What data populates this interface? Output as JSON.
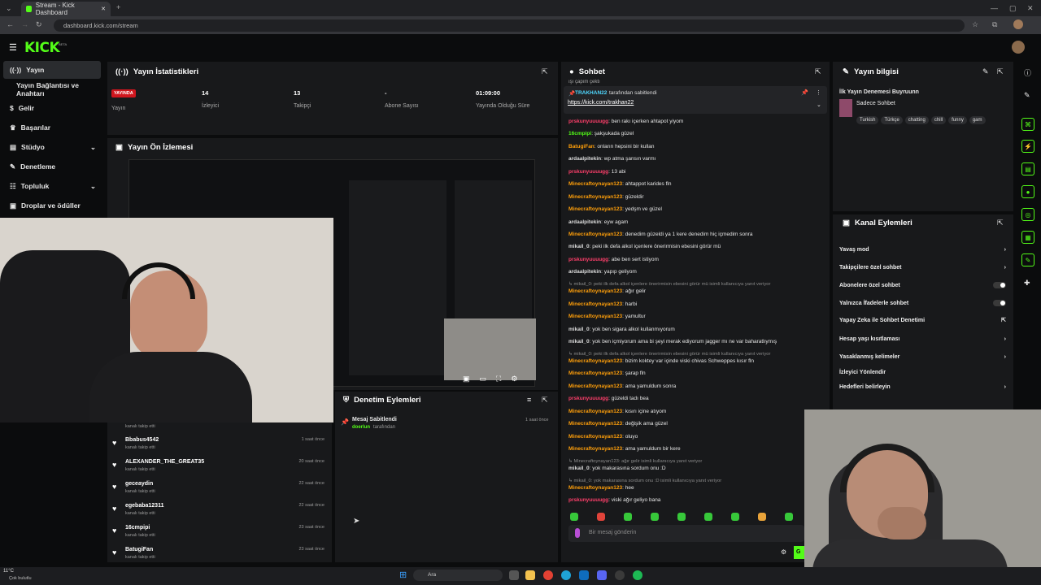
{
  "browser": {
    "tab_title": "Stream - Kick Dashboard",
    "url": "dashboard.kick.com/stream",
    "tab_close": "✕",
    "new_tab": "+",
    "min": "—",
    "max": "▢",
    "close": "✕"
  },
  "app": {
    "logo": "KICK",
    "logo_badge": "BETA"
  },
  "sidebar": {
    "items": [
      {
        "label": "Yayın"
      },
      {
        "label": "Yayın Bağlantısı ve Anahtarı"
      },
      {
        "label": "Gelir"
      },
      {
        "label": "Başarılar"
      },
      {
        "label": "Stüdyo"
      },
      {
        "label": "Denetleme"
      },
      {
        "label": "Topluluk"
      },
      {
        "label": "Droplar ve ödüller"
      }
    ]
  },
  "stats": {
    "title": "Yayın İstatistikleri",
    "live_badge": "YAYINDA",
    "live_label": "Yayın",
    "viewers_value": "14",
    "viewers_label": "İzleyici",
    "followers_value": "13",
    "followers_label": "Takipçi",
    "subs_value": "-",
    "subs_label": "Abone Sayısı",
    "uptime_value": "01:09:00",
    "uptime_label": "Yayında Olduğu Süre"
  },
  "preview": {
    "title": "Yayın Ön İzlemesi"
  },
  "followers": [
    {
      "name": "Bbabus4542",
      "sub": "kanalı takip etti",
      "time": "1 saat önce"
    },
    {
      "name": "ALEXANDER_THE_GREAT35",
      "sub": "kanalı takip etti",
      "time": "20 saat önce"
    },
    {
      "name": "geceaydin",
      "sub": "kanalı takip etti",
      "time": "22 saat önce"
    },
    {
      "name": "egebaba12311",
      "sub": "kanalı takip etti",
      "time": "22 saat önce"
    },
    {
      "name": "16cmpipi",
      "sub": "kanalı takip etti",
      "time": "23 saat önce"
    },
    {
      "name": "BatugiFan",
      "sub": "kanalı takip etti",
      "time": "23 saat önce"
    }
  ],
  "follow_top_sub": "kanalı takip etti",
  "moderation": {
    "title": "Denetim Eylemleri",
    "item_title": "Mesaj Sabitlendi",
    "item_user": "doerlun",
    "item_suffix": "tarafından",
    "item_time": "1 saat önce"
  },
  "chat": {
    "title": "Sohbet",
    "top_partial": "ışı çapım çektı",
    "pinned_user": "TRAKHAN22",
    "pinned_suffix": "tarafından sabitlendi",
    "pinned_link": "https://kick.com/trakhan22",
    "input_placeholder": "Bir mesaj gönderin",
    "send_label": "G",
    "messages": [
      {
        "u": "prskunyuuuugg",
        "c": "pk",
        "t": ": ben rakı içerken ahtapot yiyom"
      },
      {
        "u": "16cmpipi",
        "c": "gr",
        "t": ": şakşukada güzel"
      },
      {
        "u": "BatugiFan",
        "c": "or",
        "t": ": onların hepsini bir kullan"
      },
      {
        "u": "ardaalpitekin",
        "c": "wh",
        "t": ": wp atma şansın varmı"
      },
      {
        "u": "prskunyuuuugg",
        "c": "pk",
        "t": ": 13 abi"
      },
      {
        "u": "Minecraftoynayan123",
        "c": "or",
        "t": ": ahtappot karides fln"
      },
      {
        "u": "Minecraftoynayan123",
        "c": "or",
        "t": ": güzeldir"
      },
      {
        "u": "Minecraftoynayan123",
        "c": "or",
        "t": ": yedşm ve güzel"
      },
      {
        "u": "ardaalpitekin",
        "c": "wh",
        "t": ": eyw agam"
      },
      {
        "u": "Minecraftoynayan123",
        "c": "or",
        "t": ": denedim güzeldi ya 1 kere denedim hiç içmedim sonra"
      },
      {
        "u": "mikail_0",
        "c": "wh",
        "t": ": peki ilk defa alkol içenlere önerirmisin ebesini görür mü"
      },
      {
        "u": "prskunyuuuugg",
        "c": "pk",
        "t": ": abe ben sert istiyom"
      },
      {
        "u": "ardaalpitekin",
        "c": "wh",
        "t": ": yapıp geliyom"
      },
      {
        "reply": "↳ mikail_0: peki ilk defa alkol içenlere önerirmisin ebesini görür mü isimli kullanıcıya yanıt veriyor"
      },
      {
        "u": "Minecraftoynayan123",
        "c": "or",
        "t": ": ağır gelir"
      },
      {
        "u": "Minecraftoynayan123",
        "c": "or",
        "t": ": harbi"
      },
      {
        "u": "Minecraftoynayan123",
        "c": "or",
        "t": ": yamultur"
      },
      {
        "u": "mikail_0",
        "c": "wh",
        "t": ": yok ben sigara alkol kullanmıyorum"
      },
      {
        "u": "mikail_0",
        "c": "wh",
        "t": ": yok ben içmiyorum ama bi şeyi merak ediyorum jagger mı ne var baharatlıymış"
      },
      {
        "reply": "↳ mikail_0: peki ilk defa alkol içenlere önerirmisin ebesini görür mü isimli kullanıcıya yanıt veriyor"
      },
      {
        "u": "Minecraftoynayan123",
        "c": "or",
        "t": ": bizim koktey var içinde viski chivas Schweppes kısır fln"
      },
      {
        "u": "Minecraftoynayan123",
        "c": "or",
        "t": ": şarap fln"
      },
      {
        "u": "Minecraftoynayan123",
        "c": "or",
        "t": ": ama yamuldum sonra"
      },
      {
        "u": "prskunyuuuugg",
        "c": "pk",
        "t": ": güzeldi tadı bea"
      },
      {
        "u": "Minecraftoynayan123",
        "c": "or",
        "t": ": kısırı içine atıyom"
      },
      {
        "u": "Minecraftoynayan123",
        "c": "or",
        "t": ": değişik ama güzel"
      },
      {
        "u": "Minecraftoynayan123",
        "c": "or",
        "t": ": oluyo"
      },
      {
        "u": "Minecraftoynayan123",
        "c": "or",
        "t": ": ama yamuldum bir kere"
      },
      {
        "reply": "↳ Minecraftoynayan123: ağır gelir isimli kullanıcıya yanıt veriyor"
      },
      {
        "u": "mikail_0",
        "c": "wh",
        "t": ": yok makarasına sordum onu :D"
      },
      {
        "reply": "↳ mikail_0: yok makarasına sordum onu :D isimli kullanıcıya yanıt veriyor"
      },
      {
        "u": "Minecraftoynayan123",
        "c": "or",
        "t": ": hee"
      },
      {
        "u": "prskunyuuuugg",
        "c": "pk",
        "t": ": viski ağır geliyo bana"
      }
    ]
  },
  "stream_info": {
    "title": "Yayın bilgisi",
    "stream_title": "İlk Yayın Denemesi Buyruunn",
    "category": "Sadece Sohbet",
    "tags": [
      "Turkish",
      "Türkçe",
      "chatting",
      "chill",
      "funny",
      "gam"
    ]
  },
  "channel_actions": {
    "title": "Kanal Eylemleri",
    "items": [
      {
        "label": "Yavaş mod",
        "ctl": "chev"
      },
      {
        "label": "Takipçilere özel sohbet",
        "ctl": "chev"
      },
      {
        "label": "Abonelere özel sohbet",
        "ctl": "toggle"
      },
      {
        "label": "Yalnızca İfadelerle sohbet",
        "ctl": "toggle"
      },
      {
        "label": "Yapay Zeka ile Sohbet Denetimi",
        "ctl": "ext"
      },
      {
        "label": "Hesap yaşı kısıtlaması",
        "ctl": "chev"
      },
      {
        "label": "Yasaklanmış kelimeler",
        "ctl": "chev"
      },
      {
        "label": "İzleyici Yönlendir",
        "ctl": ""
      },
      {
        "label": "Hedefleri belirleyin",
        "ctl": "chev"
      }
    ]
  },
  "taskbar": {
    "weather_temp": "11°C",
    "weather_desc": "Çok bulutlu",
    "search": "Ara"
  }
}
